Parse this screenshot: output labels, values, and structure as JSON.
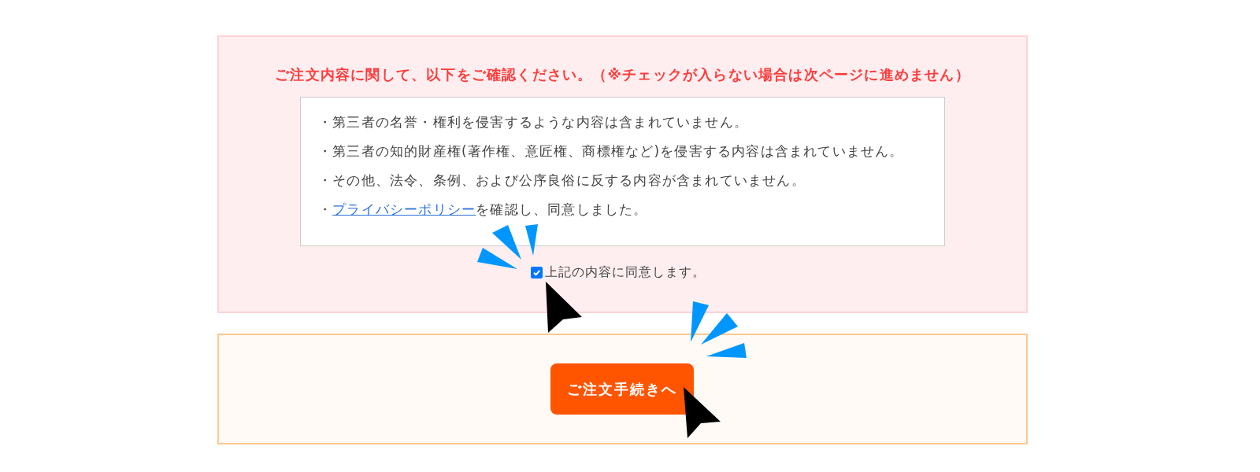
{
  "confirmation": {
    "heading": "ご注文内容に関して、以下をご確認ください。（※チェックが入らない場合は次ページに進めません）",
    "items": [
      {
        "text": "・第三者の名誉・権利を侵害するような内容は含まれていません。"
      },
      {
        "text": "・第三者の知的財産権(著作権、意匠権、商標権など)を侵害する内容は含まれていません。"
      },
      {
        "text": "・その他、法令、条例、および公序良俗に反する内容が含まれていません。"
      },
      {
        "text": "・",
        "link": "プライバシーポリシー",
        "after": "を確認し、同意しました。"
      }
    ],
    "agreement": {
      "label": "上記の内容に同意します。",
      "checked": true
    }
  },
  "order": {
    "button": "ご注文手続きへ"
  }
}
